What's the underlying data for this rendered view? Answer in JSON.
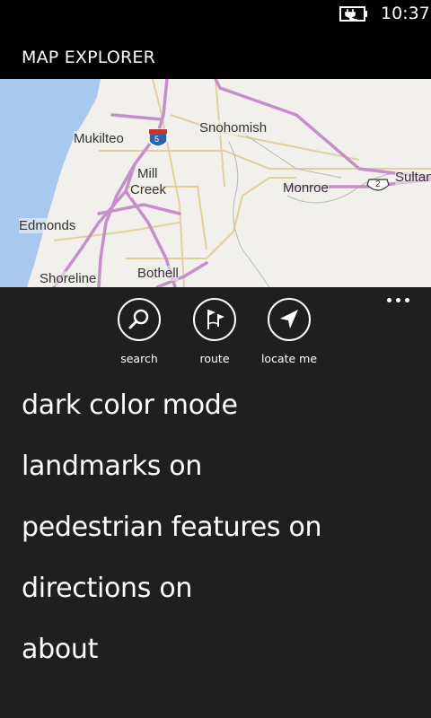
{
  "status_bar": {
    "time": "10:37",
    "battery_icon": "battery-charging-icon"
  },
  "app": {
    "title": "MAP EXPLORER"
  },
  "map": {
    "labels": {
      "mukilteo": "Mukilteo",
      "snohomish": "Snohomish",
      "mill": "Mill",
      "creek": "Creek",
      "monroe": "Monroe",
      "sultan": "Sultan",
      "edmonds": "Edmonds",
      "shoreline": "Shoreline",
      "bothell": "Bothell",
      "shield_5": "5",
      "shield_2": "2"
    },
    "colors": {
      "land": "#f1f0ec",
      "water": "#a9c8ee",
      "highway": "#c58fc9",
      "road": "#e6d3a2"
    }
  },
  "app_bar": {
    "buttons": [
      {
        "label": "search",
        "icon": "search-icon"
      },
      {
        "label": "route",
        "icon": "route-flags-icon"
      },
      {
        "label": "locate me",
        "icon": "locate-arrow-icon"
      }
    ],
    "more_icon": "ellipsis-icon"
  },
  "menu": {
    "items": [
      {
        "label": "dark color mode"
      },
      {
        "label": "landmarks on"
      },
      {
        "label": "pedestrian features on"
      },
      {
        "label": "directions on"
      },
      {
        "label": "about"
      }
    ]
  }
}
